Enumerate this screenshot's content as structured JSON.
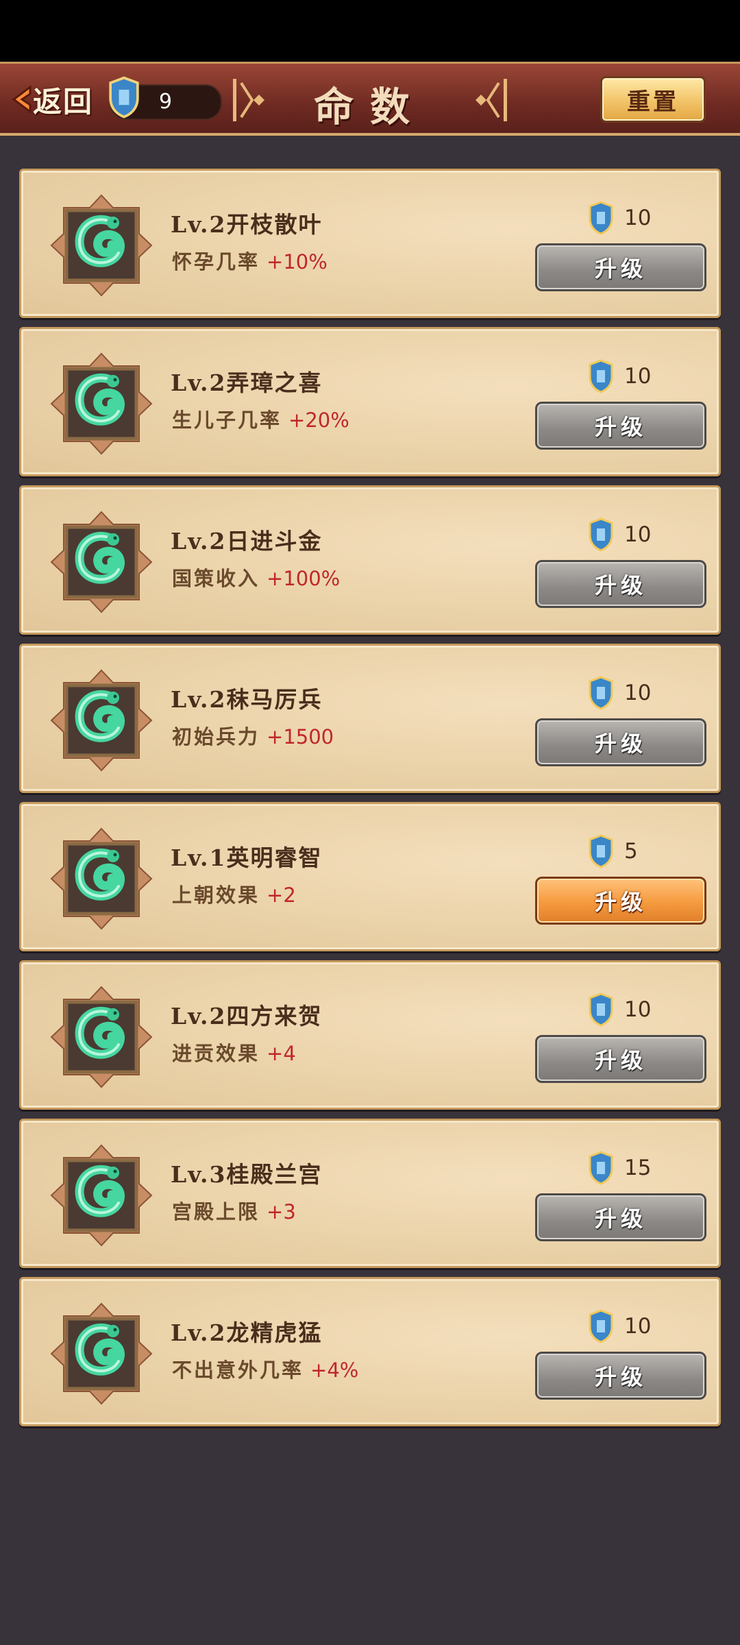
{
  "header": {
    "back_label": "返回",
    "currency_value": "9",
    "title": "命数",
    "reset_label": "重置"
  },
  "skills": [
    {
      "name": "Lv.2开枝散叶",
      "effect_label": "怀孕几率",
      "effect_value": "+10%",
      "cost": "10",
      "button": "升级",
      "active": false
    },
    {
      "name": "Lv.2弄璋之喜",
      "effect_label": "生儿子几率",
      "effect_value": "+20%",
      "cost": "10",
      "button": "升级",
      "active": false
    },
    {
      "name": "Lv.2日进斗金",
      "effect_label": "国策收入",
      "effect_value": "+100%",
      "cost": "10",
      "button": "升级",
      "active": false
    },
    {
      "name": "Lv.2秣马厉兵",
      "effect_label": "初始兵力",
      "effect_value": "+1500",
      "cost": "10",
      "button": "升级",
      "active": false
    },
    {
      "name": "Lv.1英明睿智",
      "effect_label": "上朝效果",
      "effect_value": "+2",
      "cost": "5",
      "button": "升级",
      "active": true
    },
    {
      "name": "Lv.2四方来贺",
      "effect_label": "进贡效果",
      "effect_value": "+4",
      "cost": "10",
      "button": "升级",
      "active": false
    },
    {
      "name": "Lv.3桂殿兰宫",
      "effect_label": "宫殿上限",
      "effect_value": "+3",
      "cost": "15",
      "button": "升级",
      "active": false
    },
    {
      "name": "Lv.2龙精虎猛",
      "effect_label": "不出意外几率",
      "effect_value": "+4%",
      "cost": "10",
      "button": "升级",
      "active": false
    }
  ],
  "colors": {
    "background": "#38323a",
    "header_red": "#7a3128",
    "card": "#ead2a8",
    "effect_value": "#c0272d",
    "button_gray": "#8b8885",
    "button_orange": "#f59a3e"
  }
}
